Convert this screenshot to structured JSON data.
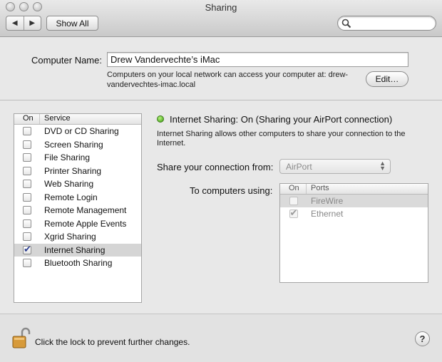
{
  "window": {
    "title": "Sharing"
  },
  "toolbar": {
    "back_glyph": "◀",
    "forward_glyph": "▶",
    "show_all_label": "Show All",
    "search_placeholder": "",
    "search_icon": "magnifier-icon"
  },
  "computer_name": {
    "label": "Computer Name:",
    "value": "Drew Vandervechte’s iMac",
    "description": "Computers on your local network can access your computer at: drew-vandervechtes-imac.local",
    "edit_label": "Edit…"
  },
  "service_list": {
    "header_on": "On",
    "header_service": "Service",
    "items": [
      {
        "label": "DVD or CD Sharing",
        "checked": false,
        "selected": false
      },
      {
        "label": "Screen Sharing",
        "checked": false,
        "selected": false
      },
      {
        "label": "File Sharing",
        "checked": false,
        "selected": false
      },
      {
        "label": "Printer Sharing",
        "checked": false,
        "selected": false
      },
      {
        "label": "Web Sharing",
        "checked": false,
        "selected": false
      },
      {
        "label": "Remote Login",
        "checked": false,
        "selected": false
      },
      {
        "label": "Remote Management",
        "checked": false,
        "selected": false
      },
      {
        "label": "Remote Apple Events",
        "checked": false,
        "selected": false
      },
      {
        "label": "Xgrid Sharing",
        "checked": false,
        "selected": false
      },
      {
        "label": "Internet Sharing",
        "checked": true,
        "selected": true
      },
      {
        "label": "Bluetooth Sharing",
        "checked": false,
        "selected": false
      }
    ]
  },
  "detail": {
    "status_color": "#3a9b12",
    "status_text": "Internet Sharing: On (Sharing your AirPort connection)",
    "description": "Internet Sharing allows other computers to share your connection to the Internet.",
    "share_from_label": "Share your connection from:",
    "share_from_value": "AirPort",
    "to_computers_label": "To computers using:",
    "ports_header_on": "On",
    "ports_header_ports": "Ports",
    "ports": [
      {
        "label": "FireWire",
        "checked": false,
        "selected": true
      },
      {
        "label": "Ethernet",
        "checked": true,
        "selected": false
      }
    ]
  },
  "footer": {
    "lock_text": "Click the lock to prevent further changes.",
    "lock_icon": "open-lock-icon",
    "help_label": "?"
  }
}
